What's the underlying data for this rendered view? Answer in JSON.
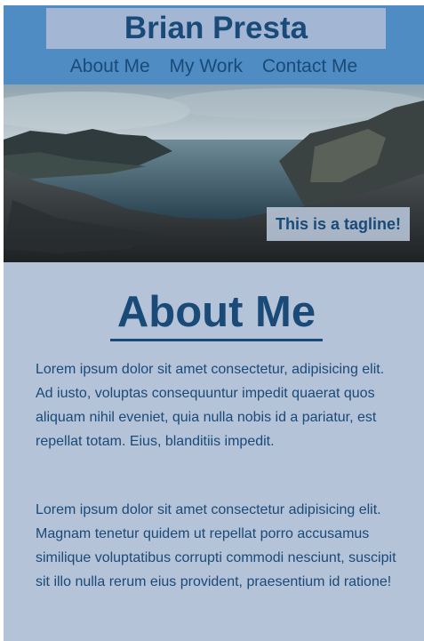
{
  "site": {
    "title": "Brian Presta"
  },
  "nav": {
    "items": [
      {
        "label": "About Me"
      },
      {
        "label": "My Work"
      },
      {
        "label": "Contact Me"
      }
    ]
  },
  "hero": {
    "tagline": "This is a tagline!"
  },
  "about": {
    "heading": "About Me",
    "paragraphs": [
      "Lorem ipsum dolor sit amet consectetur, adipisicing elit. Ad iusto, voluptas consequuntur impedit quaerat quos aliquam nihil eveniet, quia nulla nobis id a pariatur, est repellat totam. Eius, blanditiis impedit.",
      "Lorem ipsum dolor sit amet consectetur adipisicing elit. Magnam tenetur quidem ut repellat porro accusamus similique voluptatibus corrupti commodi nesciunt, suscipit sit illo nulla rerum eius provident, praesentium id ratione!"
    ]
  },
  "colors": {
    "header_bg": "#4e8cc3",
    "title_bg": "#a3b7d4",
    "page_bg": "#b4c3d8",
    "text": "#1a4a78"
  }
}
